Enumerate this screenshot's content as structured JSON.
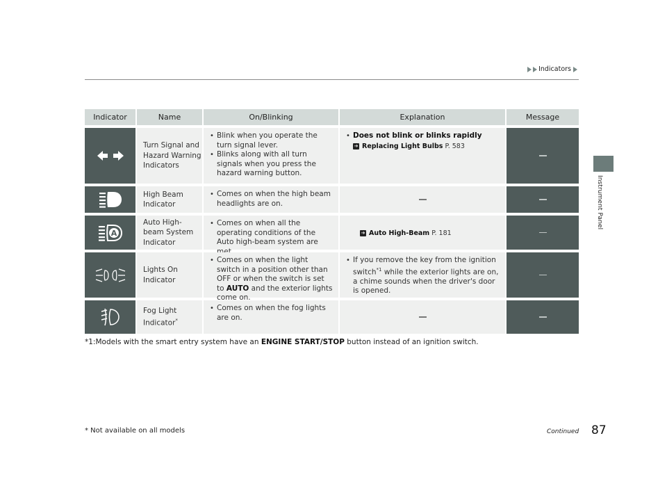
{
  "header": {
    "breadcrumb": "Indicators",
    "side_label": "Instrument Panel"
  },
  "table": {
    "columns": [
      "Indicator",
      "Name",
      "On/Blinking",
      "Explanation",
      "Message"
    ],
    "rows": [
      {
        "icon": "turn-signal-icon",
        "name": "Turn Signal and Hazard Warning Indicators",
        "on_blinking": [
          "Blink when you operate the turn signal lever.",
          "Blinks along with all turn signals when you press the hazard warning button."
        ],
        "explanation": {
          "bullet_bold": "Does not blink or blinks rapidly",
          "ref_title": "Replacing Light Bulbs",
          "ref_page": "P. 583"
        },
        "message": "—"
      },
      {
        "icon": "high-beam-icon",
        "name": "High Beam Indicator",
        "on_blinking": [
          "Comes on when the high beam headlights are on."
        ],
        "explanation": "—",
        "message": "—"
      },
      {
        "icon": "auto-high-beam-icon",
        "name": "Auto High-beam System Indicator",
        "on_blinking": [
          "Comes on when all the operating conditions of the Auto high-beam system are met."
        ],
        "explanation": {
          "ref_title": "Auto High-Beam",
          "ref_page": "P. 181"
        },
        "message": "—"
      },
      {
        "icon": "lights-on-icon",
        "name": "Lights On Indicator",
        "on_blinking": {
          "pre": "Comes on when the light switch in a position other than OFF or when the switch is set to ",
          "bold": "AUTO",
          "post": " and the exterior lights come on."
        },
        "explanation": {
          "pre": "If you remove the key from the ignition switch",
          "sup": "*1",
          "post": " while the exterior lights are on, a chime sounds when the driver's door is opened."
        },
        "message": "—"
      },
      {
        "icon": "fog-light-icon",
        "name": "Fog Light Indicator",
        "name_sup": "*",
        "on_blinking": [
          "Comes on when the fog lights are on."
        ],
        "explanation": "—",
        "message": "—"
      }
    ]
  },
  "footnote": {
    "pre": "*1:Models with the smart entry system have an ",
    "bold": "ENGINE START/STOP",
    "post": " button instead of an ignition switch."
  },
  "footer": {
    "note": "* Not available on all models",
    "continued": "Continued",
    "page_number": "87"
  },
  "colors": {
    "header_bg": "#d3dad8",
    "dark_cell": "#4f5b5a",
    "light_cell": "#eff0ef",
    "side_tab": "#6c7c7a"
  }
}
